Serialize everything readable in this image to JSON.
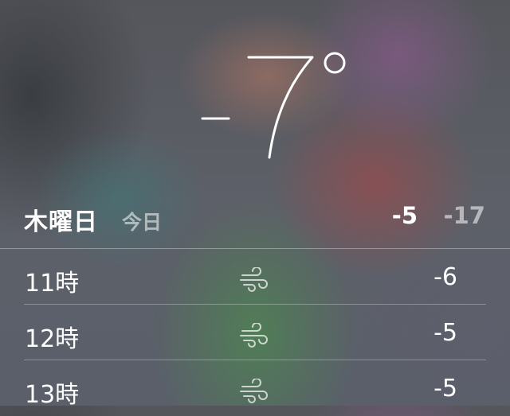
{
  "current": {
    "temperature": "-7°"
  },
  "today": {
    "day": "木曜日",
    "label": "今日",
    "high": "-5",
    "low": "-17"
  },
  "hourly": [
    {
      "time": "11時",
      "icon": "wind-icon",
      "temp": "-6"
    },
    {
      "time": "12時",
      "icon": "wind-icon",
      "temp": "-5"
    },
    {
      "time": "13時",
      "icon": "wind-icon",
      "temp": "-5"
    }
  ]
}
